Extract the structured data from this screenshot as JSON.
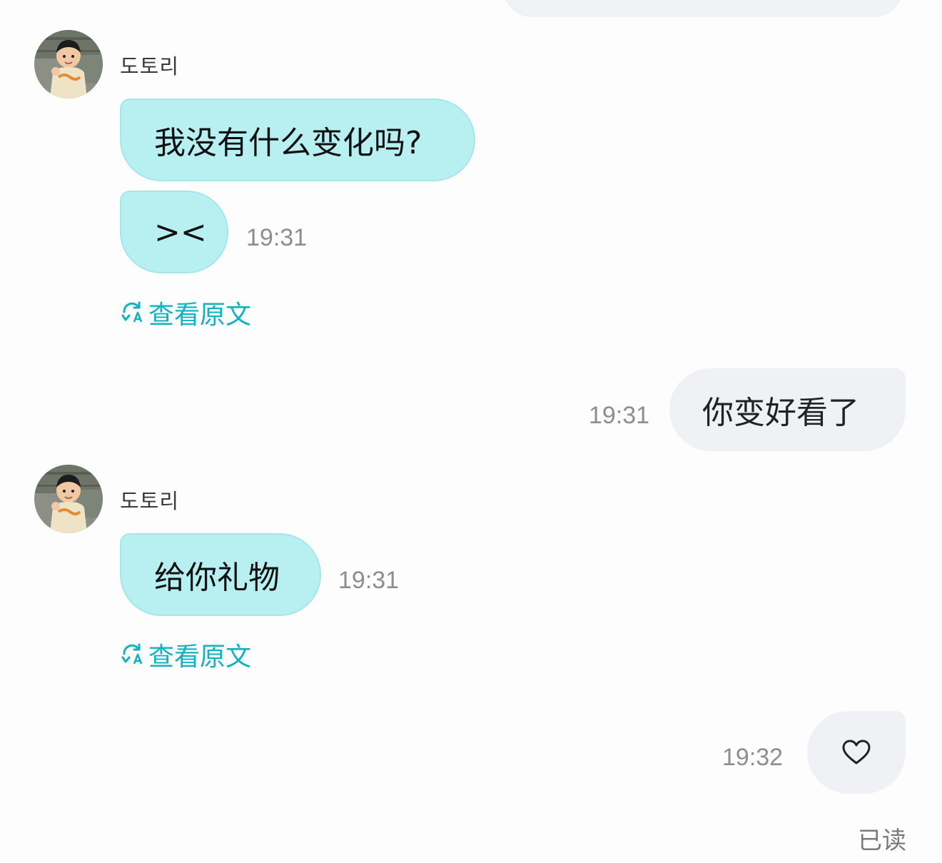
{
  "messages": [
    {
      "sender": "도토리",
      "bubbles": [
        "我没有什么变化吗?",
        "><"
      ],
      "time": "19:31",
      "translate_label": "查看原文"
    },
    {
      "direction": "outgoing",
      "text": "你变好看了",
      "time": "19:31"
    },
    {
      "sender": "도토리",
      "bubbles": [
        "给你礼物"
      ],
      "time": "19:31",
      "translate_label": "查看原文"
    },
    {
      "direction": "outgoing",
      "icon": "heart-outline-icon",
      "time": "19:32"
    }
  ],
  "read_status": "已读",
  "colors": {
    "incoming_bubble": "#b8f0f2",
    "outgoing_bubble": "#f0f1f5",
    "link": "#12b3c0",
    "timestamp": "#8e8e8e"
  }
}
